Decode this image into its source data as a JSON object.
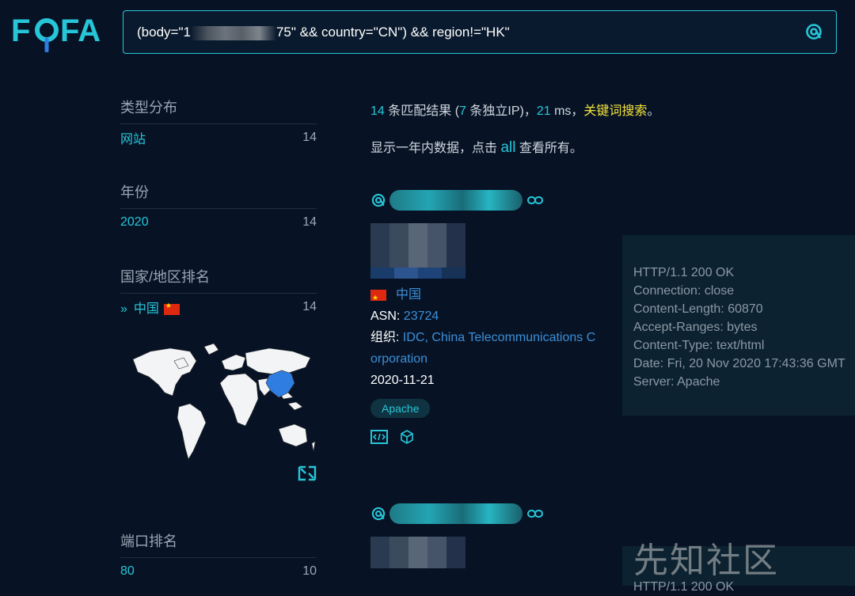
{
  "logo": {
    "text": "FOFA"
  },
  "search": {
    "query_prefix": "(body=\"1",
    "query_suffix": "75\" && country=\"CN\") && region!=\"HK\""
  },
  "sidebar": {
    "type_title": "类型分布",
    "type_label": "网站",
    "type_count": "14",
    "year_title": "年份",
    "year_label": "2020",
    "year_count": "14",
    "country_title": "国家/地区排名",
    "country_label": "中国",
    "country_count": "14",
    "port_title": "端口排名",
    "port_label": "80",
    "port_count": "10"
  },
  "summary": {
    "count": "14",
    "t1": " 条匹配结果 (",
    "unique": "7",
    "t2": " 条独立IP)，",
    "ms": "21",
    "t3": " ms，",
    "keyword": "关键词搜索",
    "t4": "。",
    "notice_pre": "显示一年内数据，点击 ",
    "notice_all": "all",
    "notice_post": " 查看所有。"
  },
  "result1": {
    "country": "中国",
    "asn_key": "ASN: ",
    "asn": "23724",
    "org_key": "组织: ",
    "org1": "IDC, China Telecommunications C",
    "org2": "orporation",
    "date": "2020-11-21",
    "tag": "Apache"
  },
  "headers": [
    "HTTP/1.1 200 OK",
    "Connection: close",
    "Content-Length: 60870",
    "Accept-Ranges: bytes",
    "Content-Type: text/html",
    "Date: Fri, 20 Nov 2020 17:43:36 GMT",
    "Server: Apache"
  ],
  "headers2_first": "HTTP/1.1 200 OK",
  "watermark": "先知社区",
  "colors": {
    "accent": "#26c6d8",
    "link": "#3c8fd8",
    "keyword": "#f5e23a",
    "bg": "#071325"
  }
}
